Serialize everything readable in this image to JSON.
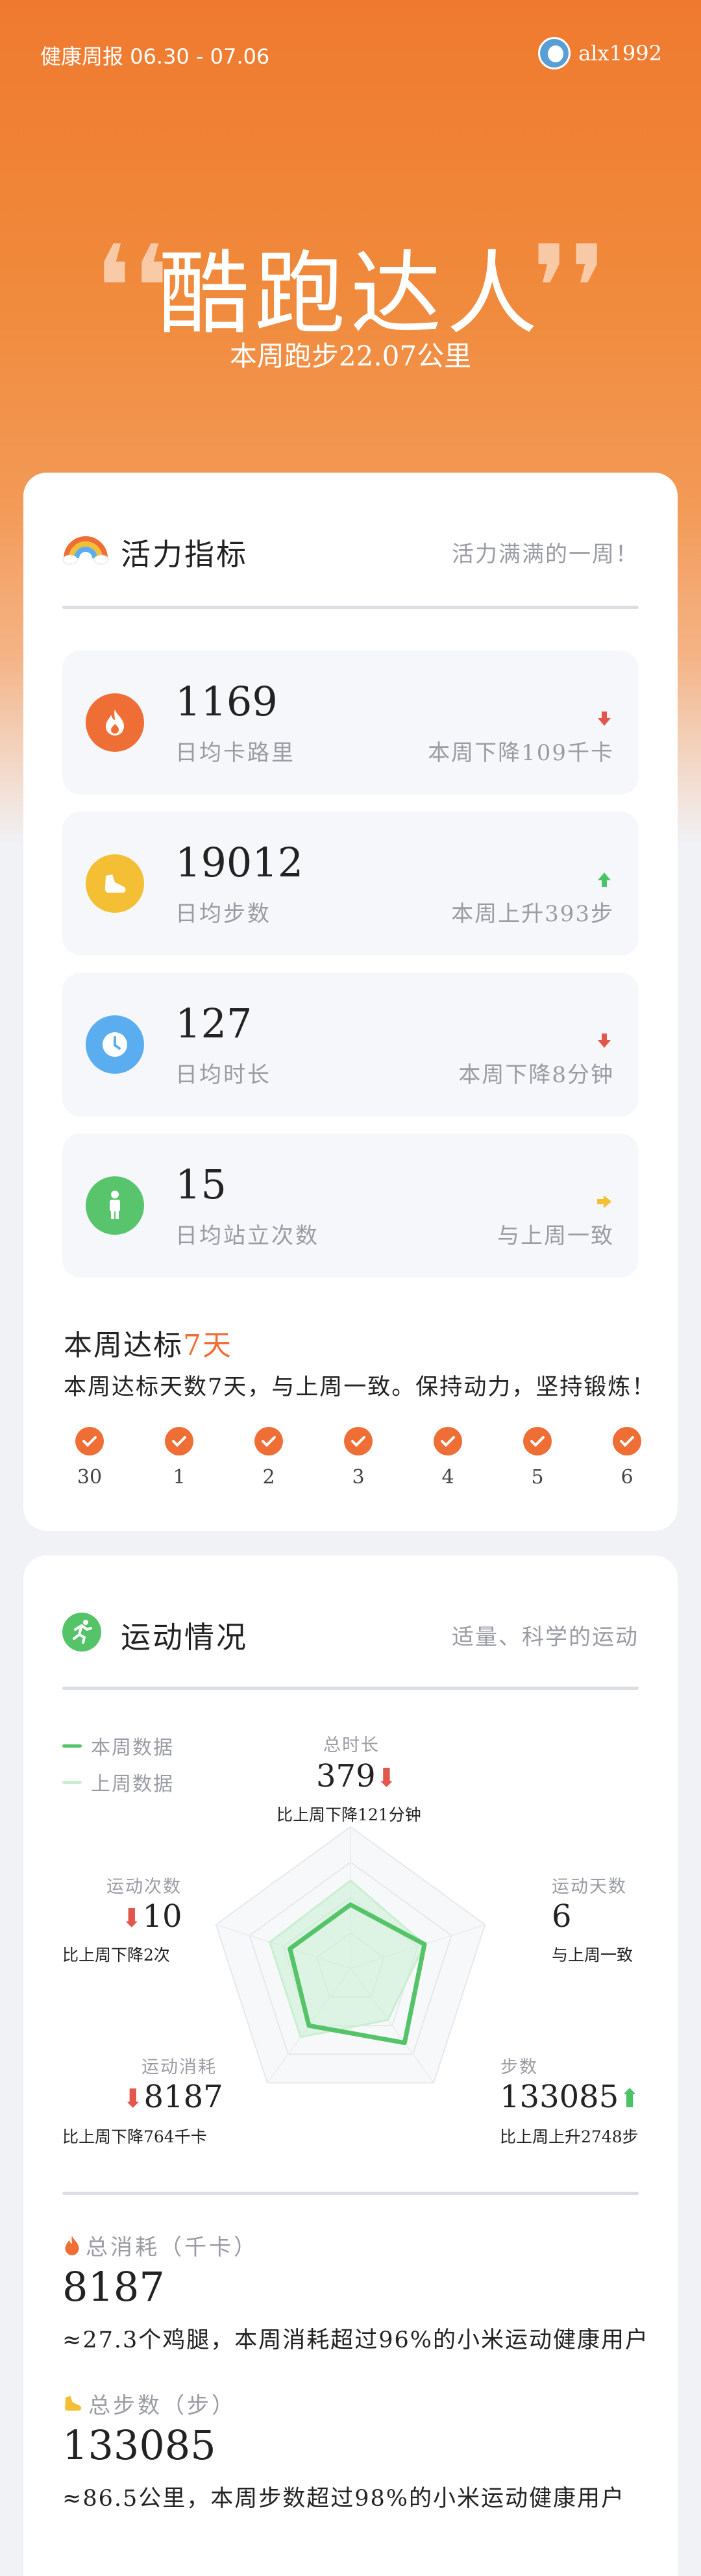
{
  "header": {
    "week_label": "健康周报 06.30 - 07.06",
    "username": "alx1992",
    "title": "酷跑达人",
    "subtitle": "本周跑步22.07公里"
  },
  "vitality": {
    "title": "活力指标",
    "note": "活力满满的一周！",
    "metrics": [
      {
        "value": "1169",
        "label": "日均卡路里",
        "change": "本周下降109千卡",
        "trend": "down",
        "icon": "flame-icon",
        "color": "#ee6e36"
      },
      {
        "value": "19012",
        "label": "日均步数",
        "change": "本周上升393步",
        "trend": "up",
        "icon": "shoe-icon",
        "color": "#f4bf34"
      },
      {
        "value": "127",
        "label": "日均时长",
        "change": "本周下降8分钟",
        "trend": "down",
        "icon": "clock-icon",
        "color": "#5aaef0"
      },
      {
        "value": "15",
        "label": "日均站立次数",
        "change": "与上周一致",
        "trend": "flat",
        "icon": "person-icon",
        "color": "#58c46c"
      }
    ],
    "streak_title": "本周达标",
    "streak_days": "7天",
    "streak_text": "本周达标天数7天，与上周一致。保持动力，坚持锻炼！",
    "days": [
      "30",
      "1",
      "2",
      "3",
      "4",
      "5",
      "6"
    ]
  },
  "exercise": {
    "title": "运动情况",
    "note": "适量、科学的运动",
    "legend_this": "本周数据",
    "legend_last": "上周数据",
    "colors": {
      "this_week": "#55c468",
      "last_week": "#c9efd1"
    },
    "axes": [
      {
        "label": "总时长",
        "value": "379",
        "trend": "down",
        "note": "比上周下降121分钟",
        "this": 0.45,
        "last": 0.62
      },
      {
        "label": "运动天数",
        "value": "6",
        "trend": "flat",
        "note": "与上周一致",
        "this": 0.55,
        "last": 0.55
      },
      {
        "label": "步数",
        "value": "133085",
        "trend": "up",
        "note": "比上周上升2748步",
        "this": 0.65,
        "last": 0.45
      },
      {
        "label": "运动消耗",
        "value": "8187",
        "trend": "down",
        "note": "比上周下降764千卡",
        "this": 0.5,
        "last": 0.6
      },
      {
        "label": "运动次数",
        "value": "10",
        "trend": "down",
        "note": "比上周下降2次",
        "this": 0.45,
        "last": 0.6
      }
    ],
    "total_energy_label": "总消耗（千卡）",
    "total_energy_value": "8187",
    "total_energy_text": "≈27.3个鸡腿，本周消耗超过96%的小米运动健康用户",
    "total_steps_label": "总步数（步）",
    "total_steps_value": "133085",
    "total_steps_text": "≈86.5公里，本周步数超过98%的小米运动健康用户"
  }
}
